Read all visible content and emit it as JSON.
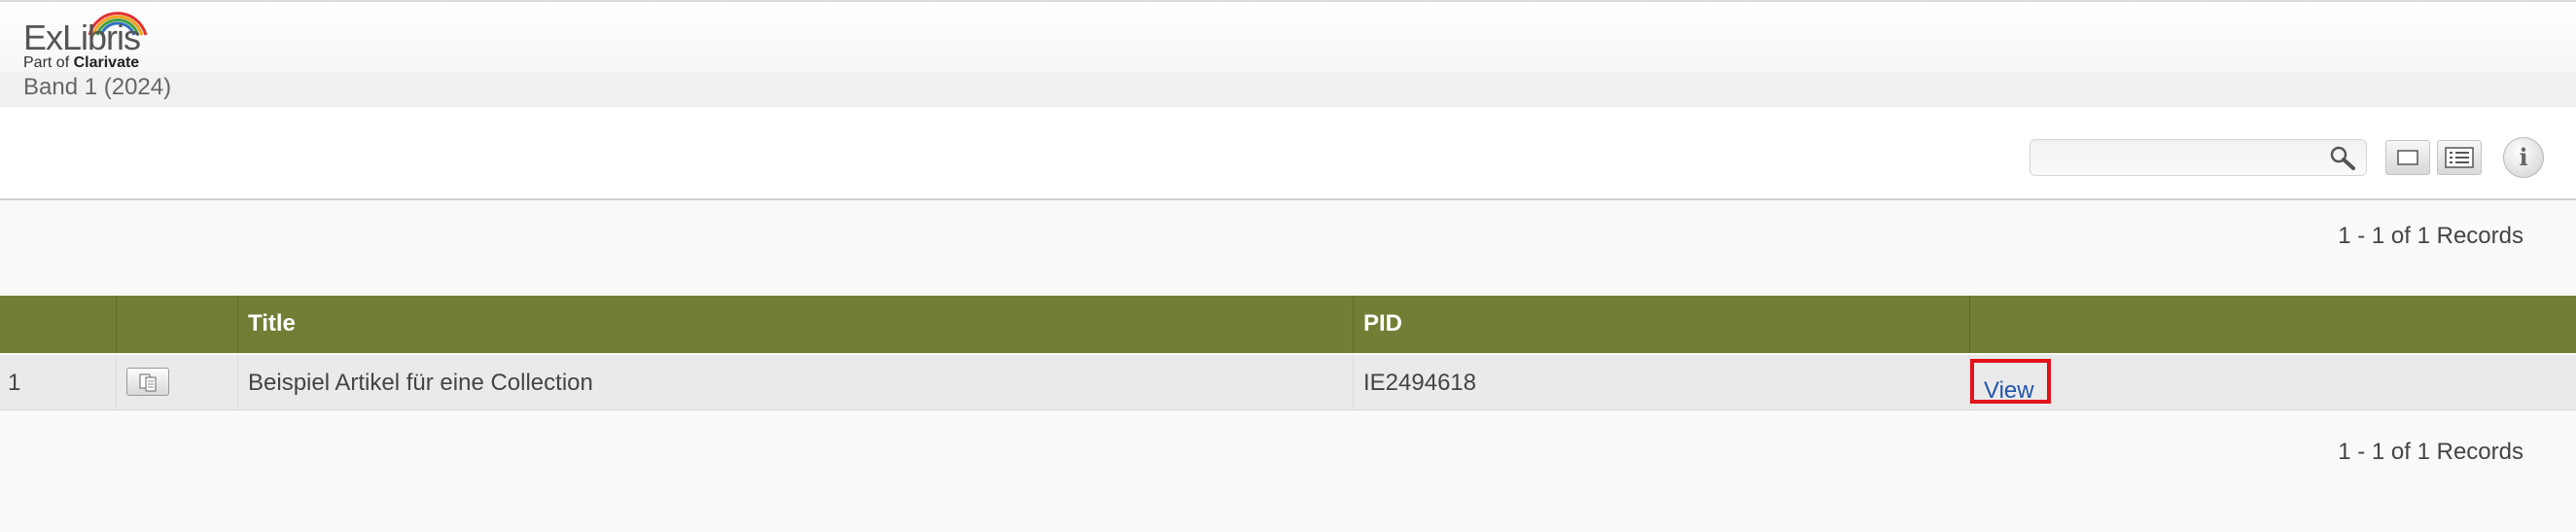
{
  "brand": {
    "logo_text": "ExLibris",
    "sub_prefix": "Part of",
    "sub_brand": "Clarivate"
  },
  "collection": {
    "title": "Band 1 (2024)"
  },
  "toolbar": {
    "search_value": "",
    "search_placeholder": "",
    "info_label": "i"
  },
  "records": {
    "summary_top": "1 - 1 of 1 Records",
    "summary_bottom": "1 - 1 of 1 Records"
  },
  "table": {
    "columns": [
      "",
      "",
      "Title",
      "PID",
      ""
    ],
    "rows": [
      {
        "num": "1",
        "title": "Beispiel Artikel für eine Collection",
        "pid": "IE2494618",
        "action": "View"
      }
    ]
  },
  "colors": {
    "header_bg": "#717f36",
    "row_bg": "#eaeaea",
    "link": "#2255aa",
    "highlight": "#e4121a"
  },
  "icons": [
    "search-icon",
    "single-view-icon",
    "list-view-icon",
    "info-icon",
    "document-icon"
  ]
}
